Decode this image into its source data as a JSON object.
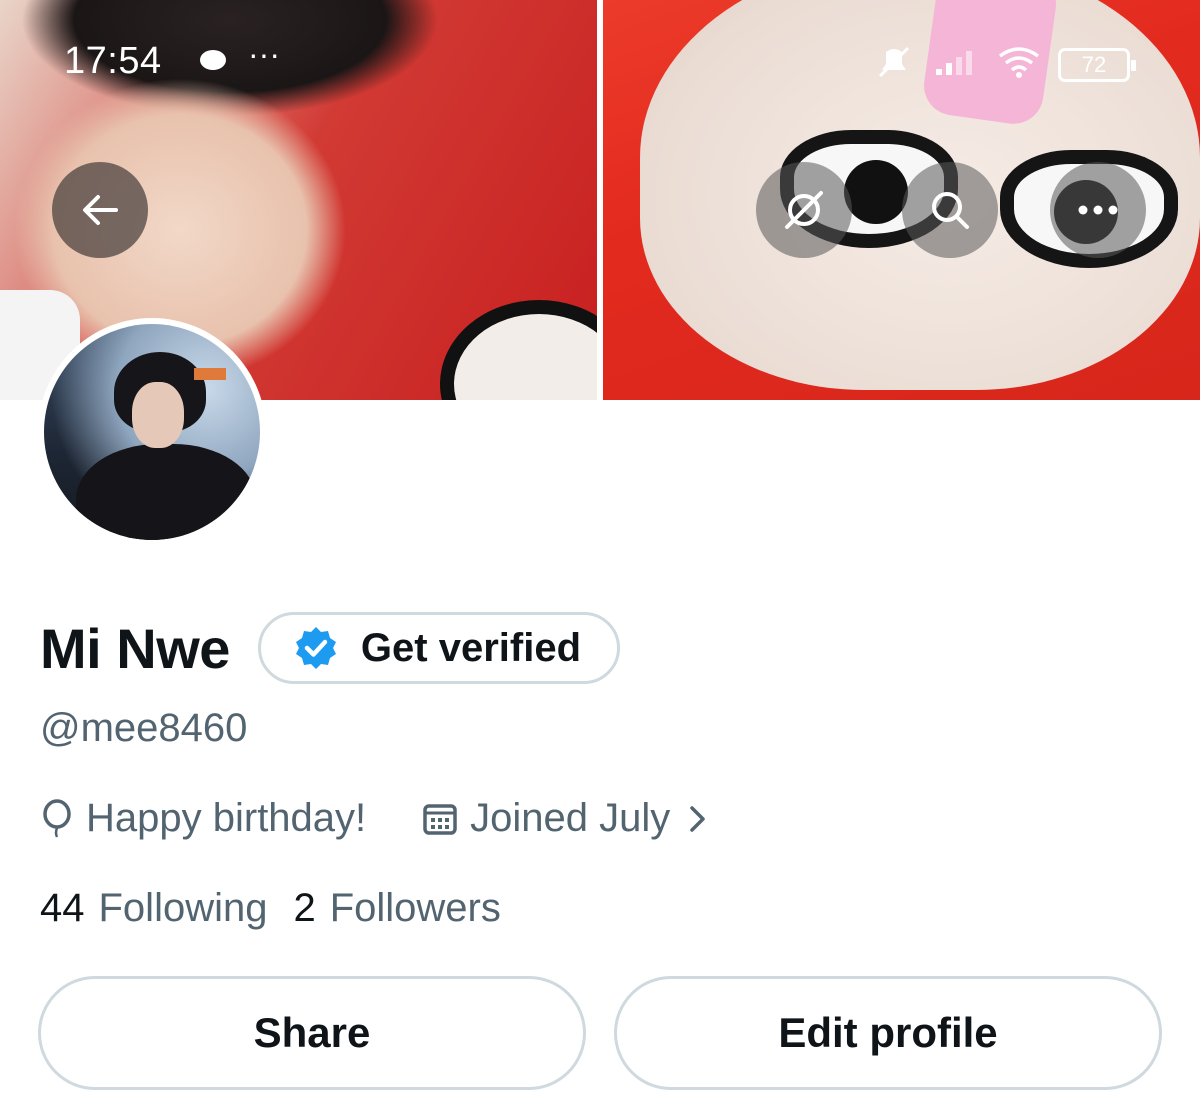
{
  "status_bar": {
    "time": "17:54",
    "overflow": "···",
    "battery": "72"
  },
  "header": {
    "back_icon": "arrow-left-icon",
    "grok_icon": "grok-icon",
    "search_icon": "search-icon",
    "more_icon": "more-horizontal-icon"
  },
  "profile": {
    "name": "Mi Nwe",
    "get_verified_label": "Get verified",
    "handle": "@mee8460",
    "birthday_text": "Happy birthday!",
    "joined_text": "Joined July",
    "following_count": "44",
    "following_label": "Following",
    "followers_count": "2",
    "followers_label": "Followers"
  },
  "actions": {
    "share_label": "Share",
    "edit_profile_label": "Edit profile"
  },
  "colors": {
    "primary_text": "#0f1419",
    "secondary_text": "#536471",
    "border": "#cfd9de",
    "verified_blue": "#1d9bf0"
  }
}
